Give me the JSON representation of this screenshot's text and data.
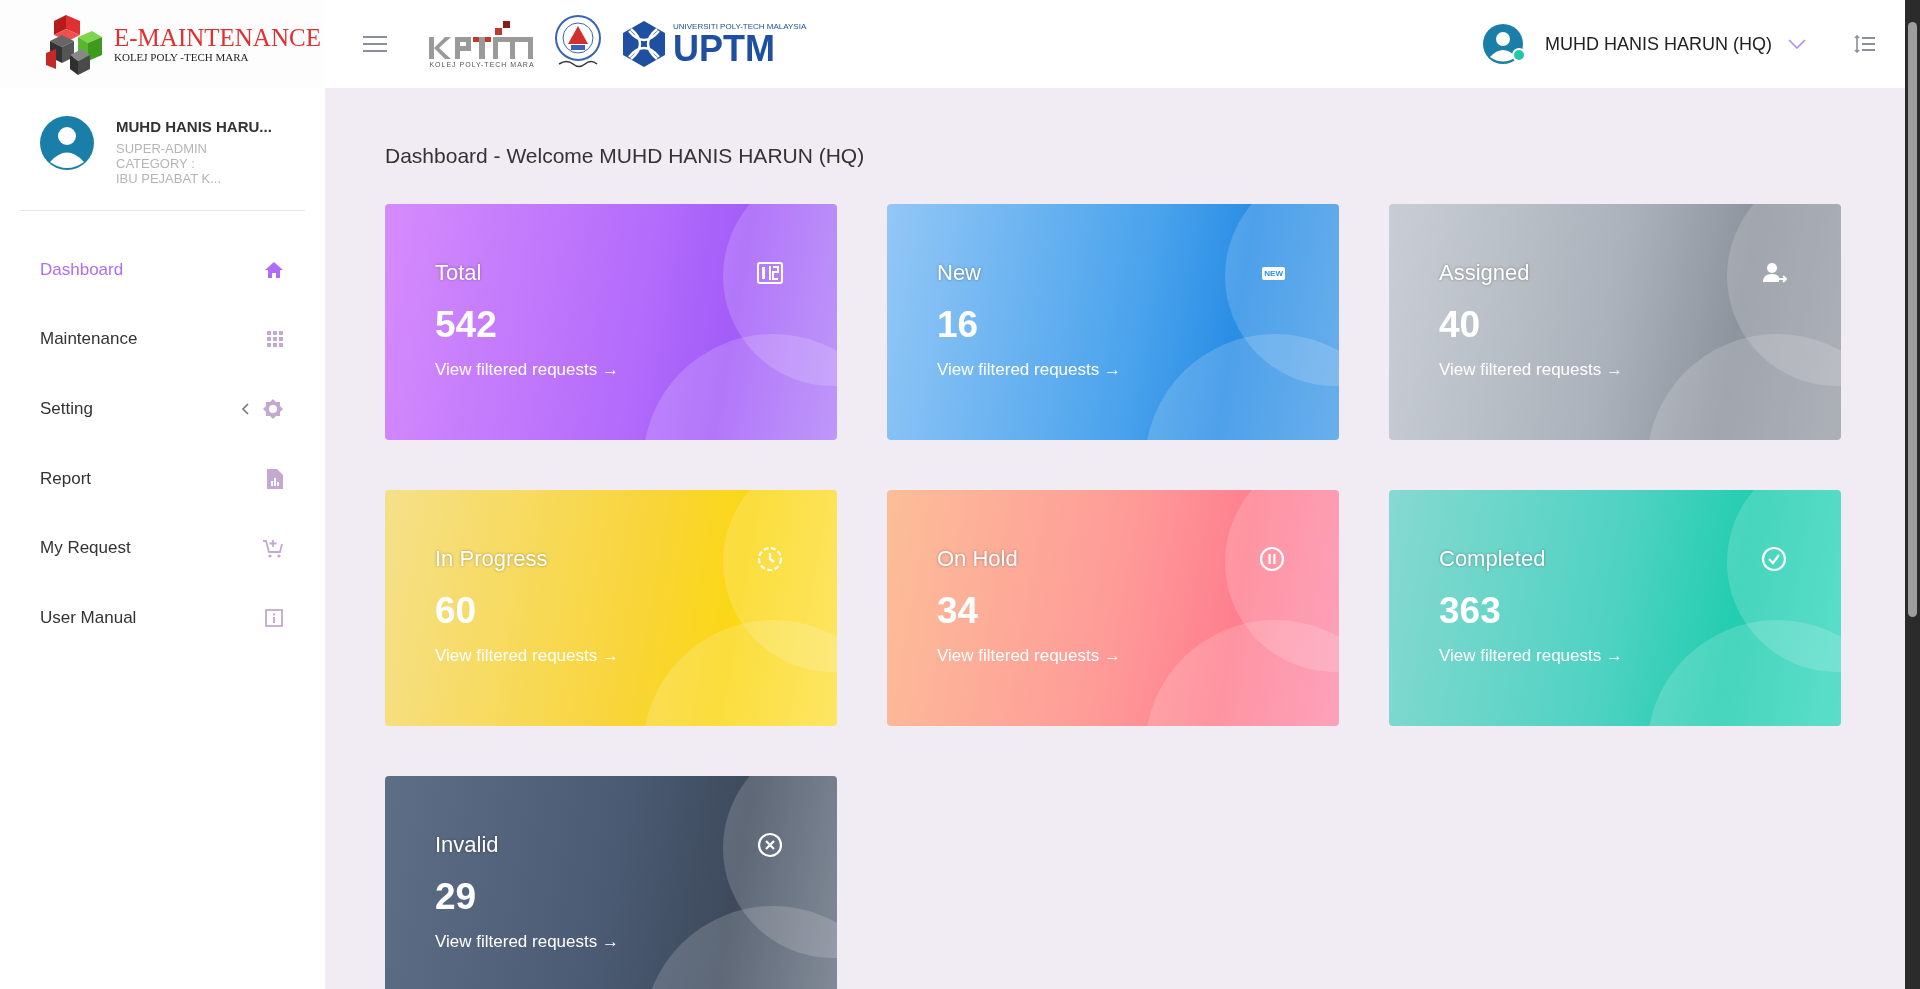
{
  "brand": {
    "title": "E-MAINTENANCE",
    "subtitle": "KOLEJ POLY -TECH MARA"
  },
  "partner_logos": [
    {
      "kind": "kptm",
      "caption": "KOLEJ POLY-TECH MARA"
    },
    {
      "kind": "seal"
    },
    {
      "kind": "uptm",
      "caption": "UNIVERSITI POLY-TECH MALAYSIA",
      "wordmark": "UPTM"
    }
  ],
  "header_user": {
    "name": "MUHD HANIS HARUN (HQ)",
    "online": true
  },
  "profile": {
    "name": "MUHD HANIS HARU...",
    "role": "SUPER-ADMIN",
    "category_label": "CATEGORY :",
    "category": "IBU PEJABAT K..."
  },
  "sidebar": {
    "items": [
      {
        "label": "Dashboard",
        "kind": "home",
        "selected": true,
        "submenu": false
      },
      {
        "label": "Maintenance",
        "kind": "grid",
        "selected": false,
        "submenu": false
      },
      {
        "label": "Setting",
        "kind": "gear",
        "selected": false,
        "submenu": true
      },
      {
        "label": "Report",
        "kind": "report",
        "selected": false,
        "submenu": false
      },
      {
        "label": "My Request",
        "kind": "cart",
        "selected": false,
        "submenu": false
      },
      {
        "label": "User Manual",
        "kind": "info",
        "selected": false,
        "submenu": false
      }
    ]
  },
  "page_title": "Dashboard - Welcome MUHD HANIS HARUN (HQ)",
  "cards": [
    {
      "kind": "total",
      "title": "Total",
      "count": "542",
      "link": "View filtered requests →"
    },
    {
      "kind": "new",
      "title": "New",
      "count": "16",
      "link": "View filtered requests →",
      "badge": "NEW"
    },
    {
      "kind": "assigned",
      "title": "Assigned",
      "count": "40",
      "link": "View filtered requests →"
    },
    {
      "kind": "progress",
      "title": "In Progress",
      "count": "60",
      "link": "View filtered requests →"
    },
    {
      "kind": "hold",
      "title": "On Hold",
      "count": "34",
      "link": "View filtered requests →"
    },
    {
      "kind": "completed",
      "title": "Completed",
      "count": "363",
      "link": "View filtered requests →"
    },
    {
      "kind": "invalid",
      "title": "Invalid",
      "count": "29",
      "link": "View filtered requests →"
    }
  ]
}
